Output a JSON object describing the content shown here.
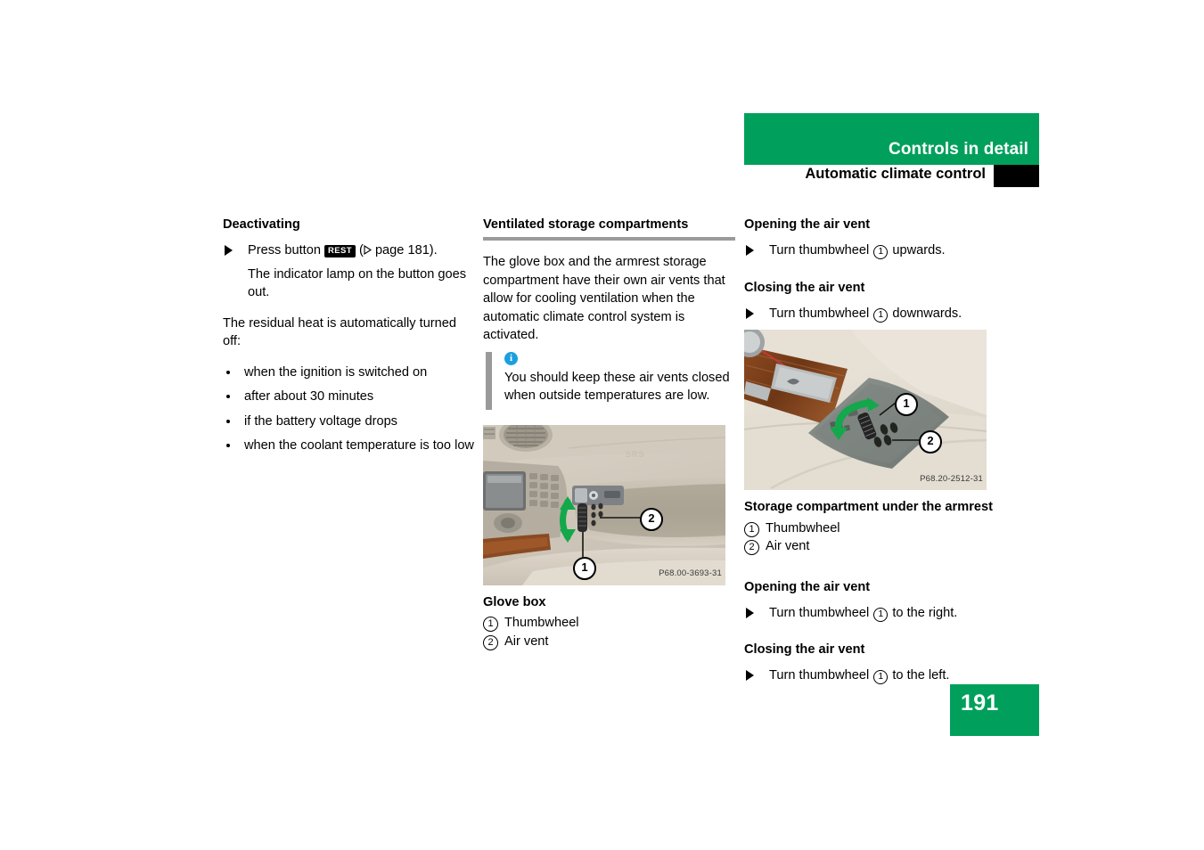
{
  "header": {
    "chapter": "Controls in detail",
    "section": "Automatic climate control"
  },
  "page_number": "191",
  "colors": {
    "brand_green": "#00A05C",
    "rule_gray": "#9A9A9A",
    "info_blue": "#1B9FE0",
    "tab_black": "#000000"
  },
  "left_column": {
    "heading": "Deactivating",
    "step_prefix": "Press button",
    "step_keycap": "REST",
    "step_reference": "page 181).",
    "step_paren_open": "(",
    "step_result": "The indicator lamp on the button goes out.",
    "intro": "The residual heat is automatically turned off:",
    "bullets": [
      "when the ignition is switched on",
      "after about 30 minutes",
      "if the battery voltage drops",
      "when the coolant temperature is too low"
    ]
  },
  "middle_column": {
    "section_title": "Ventilated storage compartments",
    "paragraph": "The glove box and the armrest storage compartment have their own air vents that allow for cooling ventilation when the automatic climate control system is activated.",
    "note": {
      "icon": "info-icon",
      "text": "You should keep these air vents closed when outside temperatures are low."
    },
    "figure": {
      "name": "glove-box-photo",
      "photo_code": "P68.00-3693-31",
      "callouts": [
        {
          "number": "1"
        },
        {
          "number": "2"
        }
      ]
    },
    "figure_caption": "Glove box",
    "legend": [
      {
        "number": "1",
        "label": "Thumbwheel"
      },
      {
        "number": "2",
        "label": "Air vent"
      }
    ]
  },
  "right_column": {
    "opening_heading_top": "Opening the air vent",
    "opening_step_top": {
      "prefix": "Turn thumbwheel",
      "number": "1",
      "suffix": "upwards."
    },
    "closing_heading_top": "Closing the air vent",
    "closing_step_top": {
      "prefix": "Turn thumbwheel",
      "number": "1",
      "suffix": "downwards."
    },
    "figure": {
      "name": "armrest-storage-photo",
      "photo_code": "P68.20-2512-31",
      "callouts": [
        {
          "number": "1"
        },
        {
          "number": "2"
        }
      ]
    },
    "figure_caption": "Storage compartment under the armrest",
    "legend": [
      {
        "number": "1",
        "label": "Thumbwheel"
      },
      {
        "number": "2",
        "label": "Air vent"
      }
    ],
    "opening_heading_bottom": "Opening the air vent",
    "opening_step_bottom": {
      "prefix": "Turn thumbwheel",
      "number": "1",
      "suffix": "to the right."
    },
    "closing_heading_bottom": "Closing the air vent",
    "closing_step_bottom": {
      "prefix": "Turn thumbwheel",
      "number": "1",
      "suffix": "to the left."
    }
  }
}
